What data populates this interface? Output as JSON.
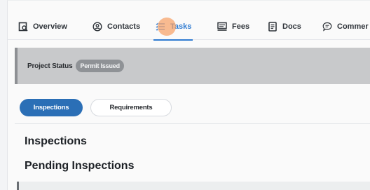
{
  "tabs": [
    {
      "label": "Overview",
      "icon": "overview-icon"
    },
    {
      "label": "Contacts",
      "icon": "contacts-icon"
    },
    {
      "label": "Tasks",
      "icon": "tasks-icon",
      "active": true
    },
    {
      "label": "Fees",
      "icon": "fees-icon"
    },
    {
      "label": "Docs",
      "icon": "docs-icon"
    },
    {
      "label": "Commer",
      "icon": "comments-icon"
    }
  ],
  "status": {
    "label": "Project Status",
    "badge": "Permit Issued"
  },
  "subtabs": [
    {
      "label": "Inspections",
      "active": true
    },
    {
      "label": "Requirements"
    }
  ],
  "main": {
    "section_title": "Inspections",
    "subsection_title": "Pending Inspections"
  },
  "colors": {
    "accent": "#2f7bd1",
    "pill_active": "#2b6fb6",
    "status_bg": "#c8c9cb",
    "badge_bg": "#8f9296",
    "cursor": "#f6a166"
  }
}
